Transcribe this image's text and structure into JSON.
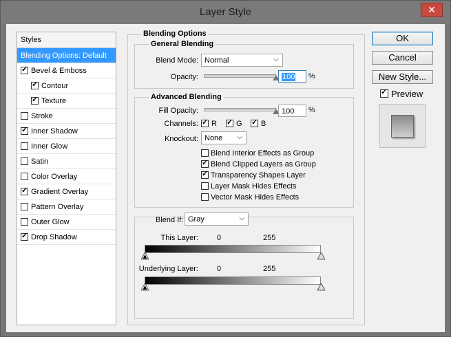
{
  "window": {
    "title": "Layer Style",
    "close_glyph": "✕"
  },
  "styles_panel": {
    "header": "Styles",
    "items": [
      {
        "label": "Blending Options: Default",
        "checkbox": null,
        "selected": true,
        "indent": false
      },
      {
        "label": "Bevel & Emboss",
        "checkbox": true,
        "selected": false,
        "indent": false
      },
      {
        "label": "Contour",
        "checkbox": true,
        "selected": false,
        "indent": true
      },
      {
        "label": "Texture",
        "checkbox": true,
        "selected": false,
        "indent": true
      },
      {
        "label": "Stroke",
        "checkbox": false,
        "selected": false,
        "indent": false
      },
      {
        "label": "Inner Shadow",
        "checkbox": true,
        "selected": false,
        "indent": false
      },
      {
        "label": "Inner Glow",
        "checkbox": false,
        "selected": false,
        "indent": false
      },
      {
        "label": "Satin",
        "checkbox": false,
        "selected": false,
        "indent": false
      },
      {
        "label": "Color Overlay",
        "checkbox": false,
        "selected": false,
        "indent": false
      },
      {
        "label": "Gradient Overlay",
        "checkbox": true,
        "selected": false,
        "indent": false
      },
      {
        "label": "Pattern Overlay",
        "checkbox": false,
        "selected": false,
        "indent": false
      },
      {
        "label": "Outer Glow",
        "checkbox": false,
        "selected": false,
        "indent": false
      },
      {
        "label": "Drop Shadow",
        "checkbox": true,
        "selected": false,
        "indent": false
      }
    ]
  },
  "blending_options": {
    "legend": "Blending Options",
    "general": {
      "legend": "General Blending",
      "blend_mode_label": "Blend Mode:",
      "blend_mode_value": "Normal",
      "opacity_label": "Opacity:",
      "opacity_value": "100",
      "opacity_unit": "%",
      "opacity_level": 1.0
    },
    "advanced": {
      "legend": "Advanced Blending",
      "fill_opacity_label": "Fill Opacity:",
      "fill_opacity_value": "100",
      "fill_opacity_unit": "%",
      "fill_opacity_level": 1.0,
      "channels_label": "Channels:",
      "channels": [
        {
          "label": "R",
          "checked": true
        },
        {
          "label": "G",
          "checked": true
        },
        {
          "label": "B",
          "checked": true
        }
      ],
      "knockout_label": "Knockout:",
      "knockout_value": "None",
      "options": [
        {
          "label": "Blend Interior Effects as Group",
          "checked": false
        },
        {
          "label": "Blend Clipped Layers as Group",
          "checked": true
        },
        {
          "label": "Transparency Shapes Layer",
          "checked": true
        },
        {
          "label": "Layer Mask Hides Effects",
          "checked": false
        },
        {
          "label": "Vector Mask Hides Effects",
          "checked": false
        }
      ]
    },
    "blend_if": {
      "label": "Blend If:",
      "value": "Gray",
      "this_layer_label": "This Layer:",
      "this_layer_low": "0",
      "this_layer_high": "255",
      "underlying_label": "Underlying Layer:",
      "underlying_low": "0",
      "underlying_high": "255"
    }
  },
  "buttons": {
    "ok": "OK",
    "cancel": "Cancel",
    "new_style": "New Style..."
  },
  "preview": {
    "label": "Preview",
    "checked": true
  },
  "colors": {
    "selection": "#3399ff",
    "close": "#c74a3e",
    "dialog_bg": "#f0f0f0"
  }
}
